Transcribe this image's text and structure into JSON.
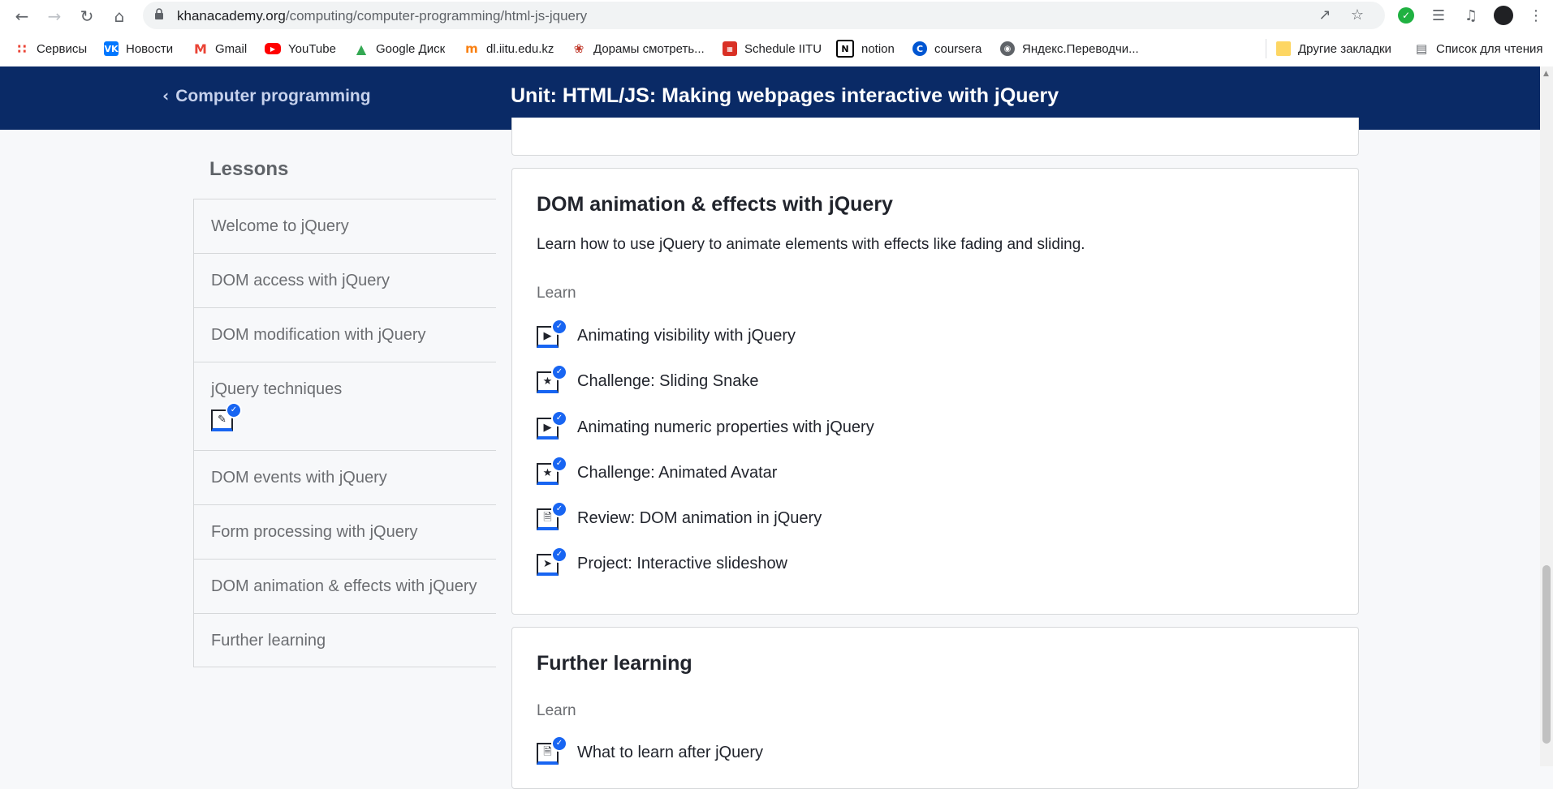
{
  "browser": {
    "url_host": "khanacademy.org",
    "url_path": "/computing/computer-programming/html-js-jquery"
  },
  "bookmarks": [
    {
      "label": "Сервисы",
      "icon": "apps-grid-icon",
      "color": "#ea4335"
    },
    {
      "label": "Новости",
      "icon": "vk-icon",
      "color": "#0077ff"
    },
    {
      "label": "Gmail",
      "icon": "gmail-icon",
      "color": "#ea4335"
    },
    {
      "label": "YouTube",
      "icon": "youtube-icon",
      "color": "#ff0000"
    },
    {
      "label": "Google Диск",
      "icon": "google-drive-icon",
      "color": "#34a853"
    },
    {
      "label": "dl.iitu.edu.kz",
      "icon": "moodle-icon",
      "color": "#f98012"
    },
    {
      "label": "Дорамы смотреть...",
      "icon": "dorama-icon",
      "color": "#c0392b"
    },
    {
      "label": "Schedule IITU",
      "icon": "calendar-icon",
      "color": "#d93025"
    },
    {
      "label": "notion",
      "icon": "notion-icon",
      "color": "#000000"
    },
    {
      "label": "coursera",
      "icon": "coursera-icon",
      "color": "#0056d2"
    },
    {
      "label": "Яндекс.Переводчи...",
      "icon": "globe-icon",
      "color": "#5f6368"
    }
  ],
  "bookmarks_right": [
    {
      "label": "Другие закладки",
      "icon": "folder-icon"
    },
    {
      "label": "Список для чтения",
      "icon": "reading-list-icon"
    }
  ],
  "header": {
    "back_label": "Computer programming",
    "unit_title": "Unit: HTML/JS: Making webpages interactive with jQuery"
  },
  "sidebar": {
    "heading": "Lessons",
    "items": [
      {
        "label": "Welcome to jQuery"
      },
      {
        "label": "DOM access with jQuery"
      },
      {
        "label": "DOM modification with jQuery"
      },
      {
        "label": "jQuery techniques"
      },
      {
        "label": "DOM events with jQuery"
      },
      {
        "label": "Form processing with jQuery"
      },
      {
        "label": "DOM animation & effects with jQuery"
      },
      {
        "label": "Further learning"
      }
    ]
  },
  "lesson_main": {
    "title": "DOM animation & effects with jQuery",
    "description": "Learn how to use jQuery to animate elements with effects like fading and sliding.",
    "learn_label": "Learn",
    "items": [
      {
        "label": "Animating visibility with jQuery",
        "icon": "video-play-icon"
      },
      {
        "label": "Challenge: Sliding Snake",
        "icon": "challenge-star-icon"
      },
      {
        "label": "Animating numeric properties with jQuery",
        "icon": "video-play-icon"
      },
      {
        "label": "Challenge: Animated Avatar",
        "icon": "challenge-star-icon"
      },
      {
        "label": "Review: DOM animation in jQuery",
        "icon": "article-doc-icon"
      },
      {
        "label": "Project: Interactive slideshow",
        "icon": "project-rocket-icon"
      }
    ]
  },
  "lesson_further": {
    "title": "Further learning",
    "learn_label": "Learn",
    "items": [
      {
        "label": "What to learn after jQuery",
        "icon": "article-doc-icon"
      }
    ]
  },
  "colors": {
    "header_bg": "#0a2a66",
    "accent_blue": "#1865f2"
  }
}
